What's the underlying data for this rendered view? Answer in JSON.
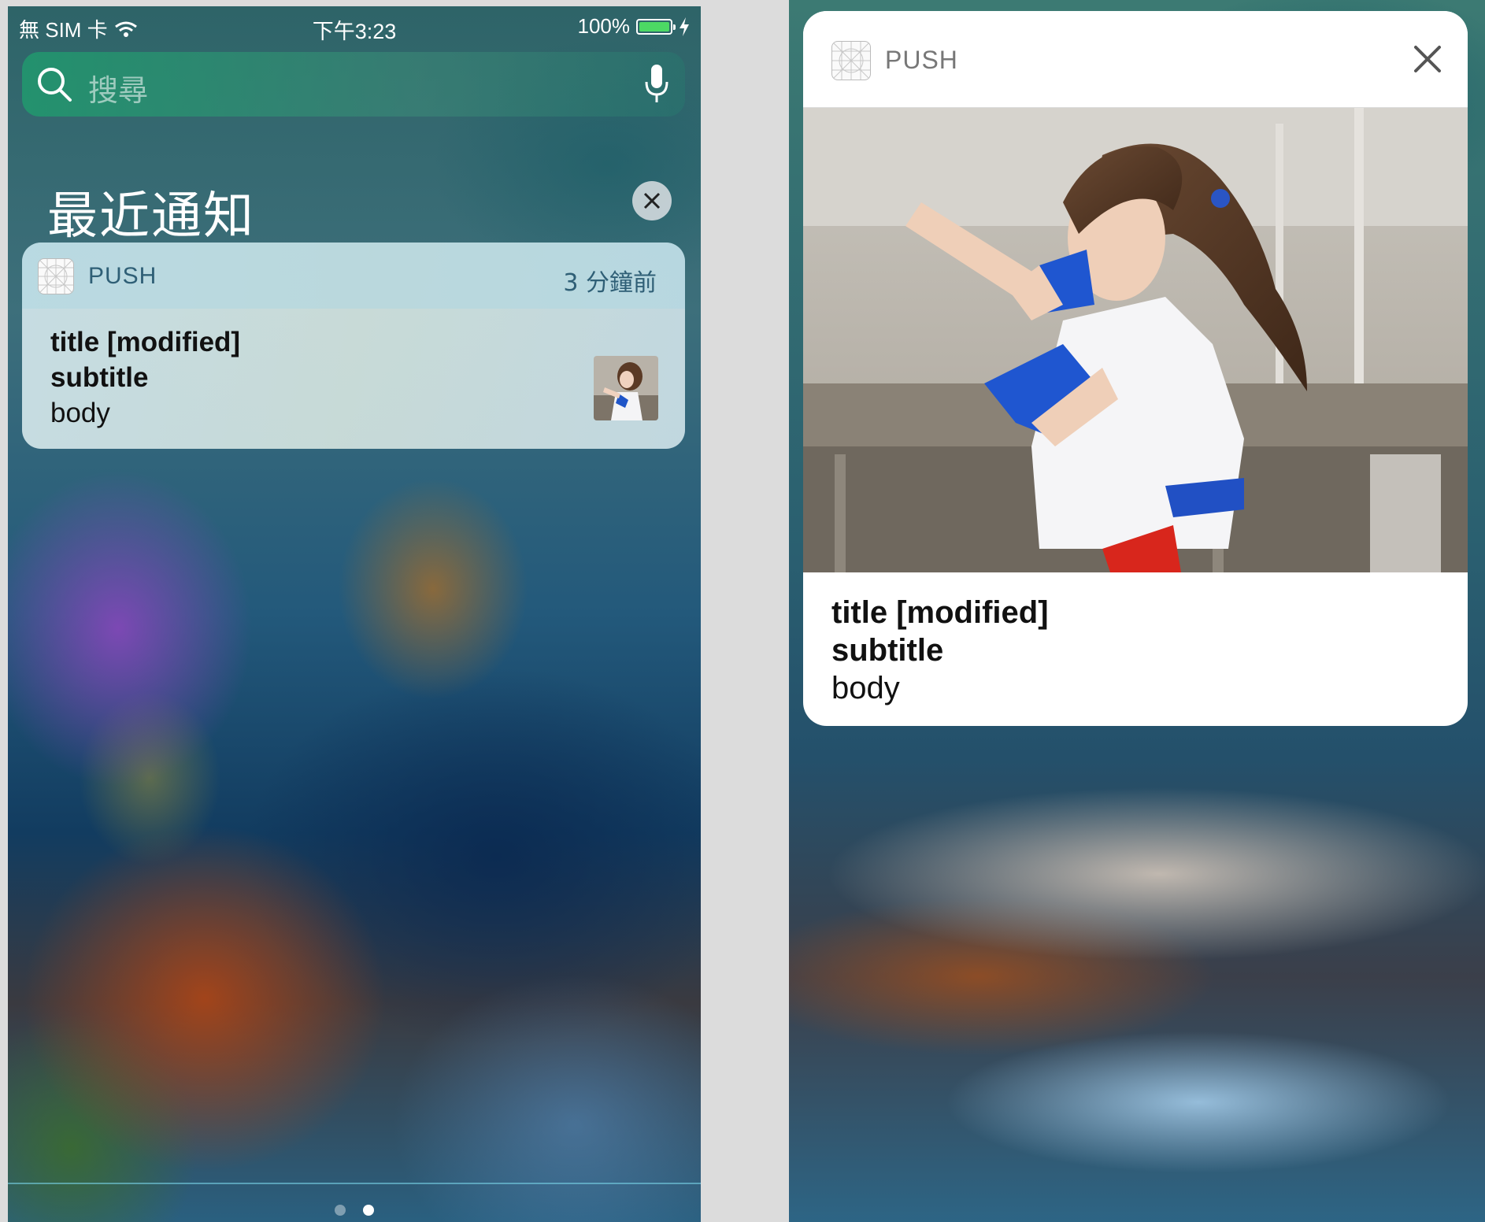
{
  "status_bar": {
    "carrier": "無 SIM 卡",
    "time": "下午3:23",
    "battery": "100%",
    "battery_level": 1.0
  },
  "search": {
    "placeholder": "搜尋"
  },
  "notification_center": {
    "section_title": "最近通知",
    "page_dots": {
      "count": 2,
      "active": 2
    }
  },
  "notification": {
    "app_name": "PUSH",
    "time_ago": "3 分鐘前",
    "title": "title [modified]",
    "subtitle": "subtitle",
    "body": "body"
  },
  "expanded_notification": {
    "app_name": "PUSH",
    "title": "title [modified]",
    "subtitle": "subtitle",
    "body": "body"
  },
  "icons": {
    "search": "search-icon",
    "mic": "microphone-icon",
    "clear": "close-icon",
    "wifi": "wifi-icon",
    "charging": "bolt-icon",
    "app": "push-app-icon"
  },
  "colors": {
    "battery_fill": "#4cd964",
    "accent_text": "#2f5f76"
  }
}
